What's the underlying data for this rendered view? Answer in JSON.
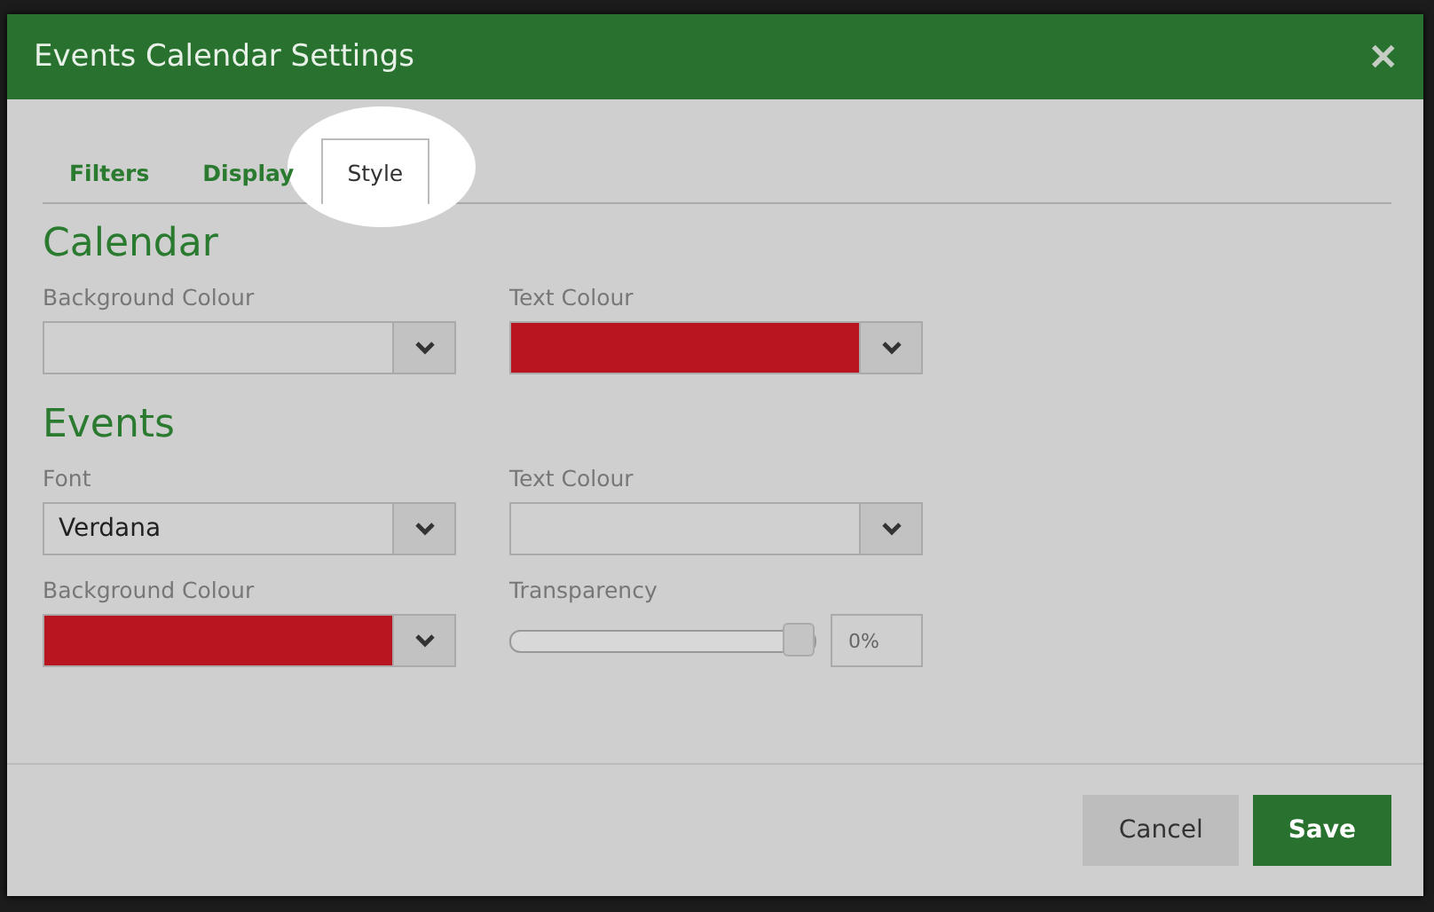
{
  "dialog": {
    "title": "Events Calendar Settings",
    "close": "✕"
  },
  "tabs": [
    {
      "label": "Filters",
      "selected": false
    },
    {
      "label": "Display",
      "selected": false
    },
    {
      "label": "Style",
      "selected": true
    }
  ],
  "sections": [
    {
      "title": "Calendar",
      "fields": [
        {
          "kind": "color",
          "label": "Background Colour"
        },
        {
          "kind": "color",
          "label": "Text Colour",
          "color": "#b91520"
        }
      ]
    },
    {
      "title": "Events",
      "fields": [
        {
          "kind": "select",
          "label": "Font",
          "value": "Verdana"
        },
        {
          "kind": "color",
          "label": "Text Colour"
        },
        {
          "kind": "color",
          "label": "Background Colour",
          "color": "#b91520"
        },
        {
          "kind": "slider",
          "label": "Transparency",
          "level": 1,
          "reading": "0%"
        }
      ]
    }
  ],
  "buttons": [
    {
      "label": "Cancel",
      "kind": "secondary"
    },
    {
      "label": "Save",
      "kind": "primary"
    }
  ]
}
